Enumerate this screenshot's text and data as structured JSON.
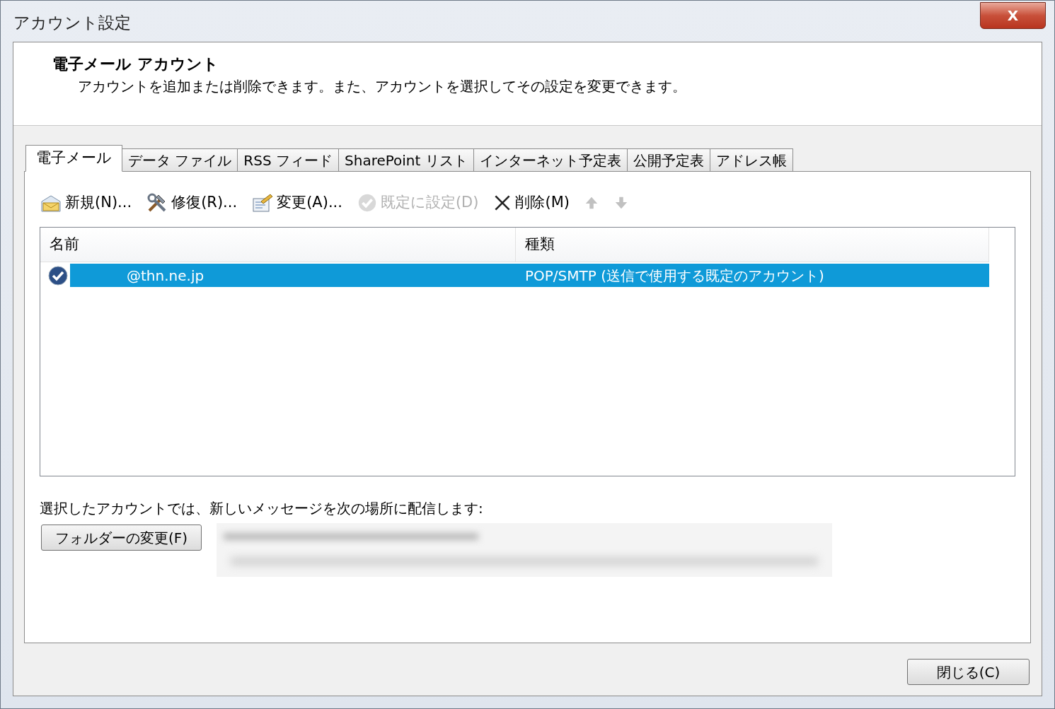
{
  "window": {
    "title": "アカウント設定",
    "close": "X"
  },
  "header": {
    "title": "電子メール アカウント",
    "description": "アカウントを追加または削除できます。また、アカウントを選択してその設定を変更できます。"
  },
  "tabs": [
    {
      "label": "電子メール",
      "selected": true
    },
    {
      "label": "データ ファイル",
      "selected": false
    },
    {
      "label": "RSS フィード",
      "selected": false
    },
    {
      "label": "SharePoint リスト",
      "selected": false
    },
    {
      "label": "インターネット予定表",
      "selected": false
    },
    {
      "label": "公開予定表",
      "selected": false
    },
    {
      "label": "アドレス帳",
      "selected": false
    }
  ],
  "toolbar": [
    {
      "kind": "new",
      "label": "新規(N)...",
      "disabled": false
    },
    {
      "kind": "repair",
      "label": "修復(R)...",
      "disabled": false
    },
    {
      "kind": "change",
      "label": "変更(A)...",
      "disabled": false
    },
    {
      "kind": "default",
      "label": "既定に設定(D)",
      "disabled": true
    },
    {
      "kind": "delete",
      "label": "削除(M)",
      "disabled": false
    },
    {
      "kind": "up",
      "disabled": true
    },
    {
      "kind": "down",
      "disabled": true
    }
  ],
  "table": {
    "columns": [
      "名前",
      "種類"
    ],
    "rows": [
      {
        "name": "@thn.ne.jp",
        "type": "POP/SMTP (送信で使用する既定のアカウント)",
        "selected": true,
        "is_default": true
      }
    ]
  },
  "delivery_label": "選択したアカウントでは、新しいメッセージを次の場所に配信します:",
  "change_folder_button": "フォルダーの変更(F)",
  "close_button": "閉じる(C)"
}
